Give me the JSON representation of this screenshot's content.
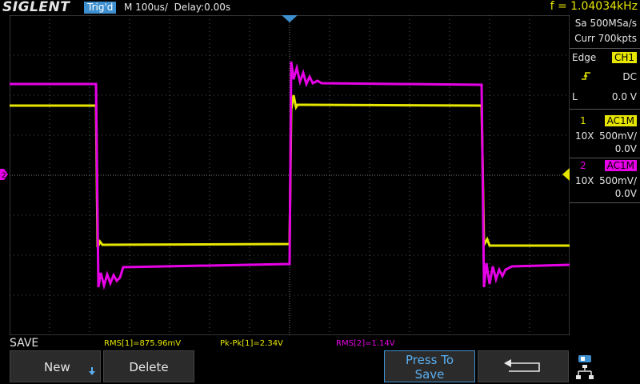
{
  "header": {
    "brand": "SIGLENT",
    "trigger_status": "Trig'd",
    "timebase": "M 100us/  Delay:0.00s",
    "frequency": "f = 1.04034kHz"
  },
  "acquisition": {
    "sample_rate": "Sa 500MSa/s",
    "memory": "Curr 700kpts"
  },
  "trigger": {
    "type_label": "Edge",
    "source": "CH1",
    "slope_icon": "rising-edge-icon",
    "coupling": "DC",
    "level_label": "L",
    "level": "0.0 V"
  },
  "channels": [
    {
      "number": "1",
      "coupling": "AC1M",
      "probe": "10X",
      "scale": "500mV/",
      "offset": "0.0V",
      "color": "#e6e600"
    },
    {
      "number": "2",
      "coupling": "AC1M",
      "probe": "10X",
      "scale": "500mV/",
      "offset": "0.0V",
      "color": "#e600e6"
    }
  ],
  "measurements": [
    {
      "text": "RMS[1]=875.96mV",
      "color": "#e6e600"
    },
    {
      "text": "Pk-Pk[1]=2.34V",
      "color": "#e6e600"
    },
    {
      "text": "RMS[2]=1.14V",
      "color": "#e600e6"
    }
  ],
  "menu": {
    "title": "SAVE",
    "new_label": "New",
    "delete_label": "Delete",
    "press_label_1": "Press To",
    "press_label_2": "Save",
    "back_icon": "return-arrow-icon",
    "usb_icon": "usb-network-icon"
  },
  "waveform_colors": {
    "ch1": "#e6e600",
    "ch2": "#e600e6",
    "trigger_marker": "#3e8fcf"
  }
}
